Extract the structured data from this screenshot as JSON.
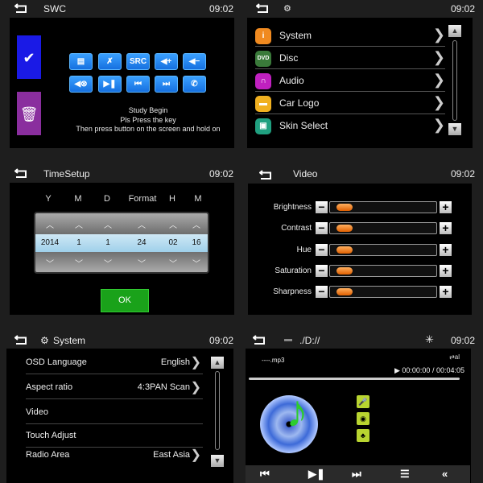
{
  "swc": {
    "title": "SWC",
    "time": "09:02",
    "confirm_icon": "checkmark-icon",
    "delete_icon": "trash-icon",
    "keys": [
      {
        "label": "",
        "icon": "radio-icon"
      },
      {
        "label": "",
        "icon": "mute-antenna-icon"
      },
      {
        "label": "SRC",
        "icon": "source"
      },
      {
        "label": "",
        "icon": "volume-up-icon"
      },
      {
        "label": "",
        "icon": "volume-down-icon"
      },
      {
        "label": "",
        "icon": "mute-icon"
      },
      {
        "label": "",
        "icon": "play-pause-icon"
      },
      {
        "label": "",
        "icon": "previous-icon"
      },
      {
        "label": "",
        "icon": "next-icon"
      },
      {
        "label": "",
        "icon": "phone-icon"
      }
    ],
    "messages": [
      "Study Begin",
      "Pls Press the key",
      "Then press button on the screen and hold on"
    ]
  },
  "settings": {
    "time": "09:02",
    "title_icon": "gear-icon",
    "items": [
      {
        "label": "System",
        "icon": "info-icon",
        "color": "#f08a20"
      },
      {
        "label": "Disc",
        "icon": "dvd-icon",
        "color": "#3a7a3a"
      },
      {
        "label": "Audio",
        "icon": "headphones-icon",
        "color": "#c020c0"
      },
      {
        "label": "Car Logo",
        "icon": "car-icon",
        "color": "#f0b020"
      },
      {
        "label": "Skin Select",
        "icon": "skin-icon",
        "color": "#20a080"
      }
    ]
  },
  "timesetup": {
    "title": "TimeSetup",
    "time": "09:02",
    "columns": [
      {
        "header": "Y",
        "value": "2014"
      },
      {
        "header": "M",
        "value": "1"
      },
      {
        "header": "D",
        "value": "1"
      },
      {
        "header": "Format",
        "value": "24"
      },
      {
        "header": "H",
        "value": "02"
      },
      {
        "header": "M",
        "value": "16"
      }
    ],
    "ok_label": "OK"
  },
  "video": {
    "title": "Video",
    "time": "09:02",
    "sliders": [
      {
        "label": "Brightness",
        "value_fraction": 0.05
      },
      {
        "label": "Contrast",
        "value_fraction": 0.05
      },
      {
        "label": "Hue",
        "value_fraction": 0.05
      },
      {
        "label": "Saturation",
        "value_fraction": 0.05
      },
      {
        "label": "Sharpness",
        "value_fraction": 0.05
      }
    ]
  },
  "system": {
    "title": "System",
    "time": "09:02",
    "rows": [
      {
        "label": "OSD Language",
        "value": "English",
        "has_arrow": true
      },
      {
        "label": "Aspect ratio",
        "value": "4:3PAN Scan",
        "has_arrow": true
      },
      {
        "label": "Video",
        "value": "",
        "has_arrow": false
      },
      {
        "label": "Touch Adjust",
        "value": "",
        "has_arrow": false
      },
      {
        "label": "Radio Area",
        "value": "East Asia",
        "has_arrow": true
      }
    ]
  },
  "media": {
    "path": "./D://",
    "time": "09:02",
    "filename": "----.mp3",
    "repeat": "⇄al",
    "elapsed": "00:00:00",
    "total": "/ 00:04:05",
    "progress_fraction": 0.0,
    "controls": [
      "previous",
      "play-pause",
      "next",
      "playlist",
      "back"
    ]
  }
}
